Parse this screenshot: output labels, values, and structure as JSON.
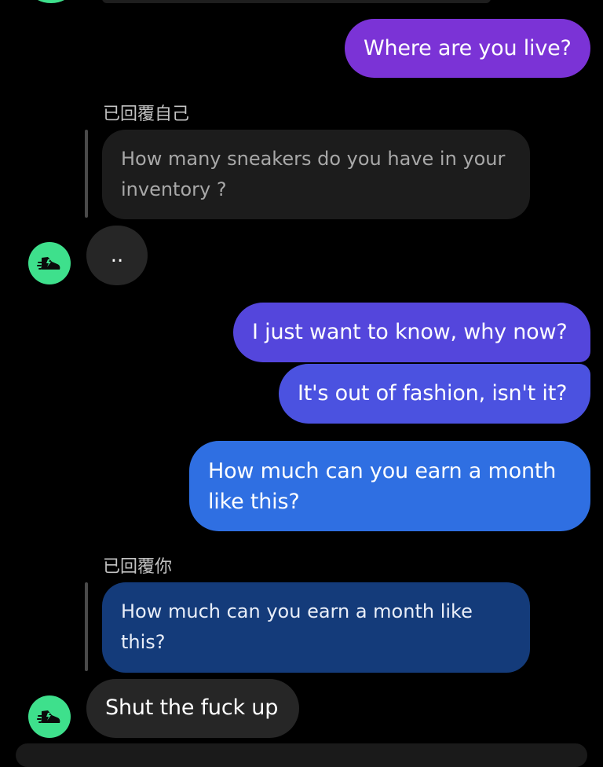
{
  "colors": {
    "background": "#000000",
    "avatar": "#3ee08c",
    "outgoing_purple": "#7b33d6",
    "outgoing_blue": "#2f6fe2",
    "incoming": "#262626",
    "reply_quote_dark": "#1c1c1c",
    "reply_quote_blue": "#143b7a"
  },
  "contact": {
    "avatar_icon": "sneaker-icon"
  },
  "messages": {
    "m1": "Where are you live?",
    "reply1_label": "已回覆自己",
    "reply1_quote": "How many sneakers do you have in your inventory ?",
    "typing": "..",
    "m2": "I just want to know, why now?",
    "m3": "It's out of fashion, isn't it?",
    "m4": "How much can you earn a month like this?",
    "reply2_label": "已回覆你",
    "reply2_quote": "How much can you earn a month like this?",
    "m5": "Shut the fuck up"
  }
}
